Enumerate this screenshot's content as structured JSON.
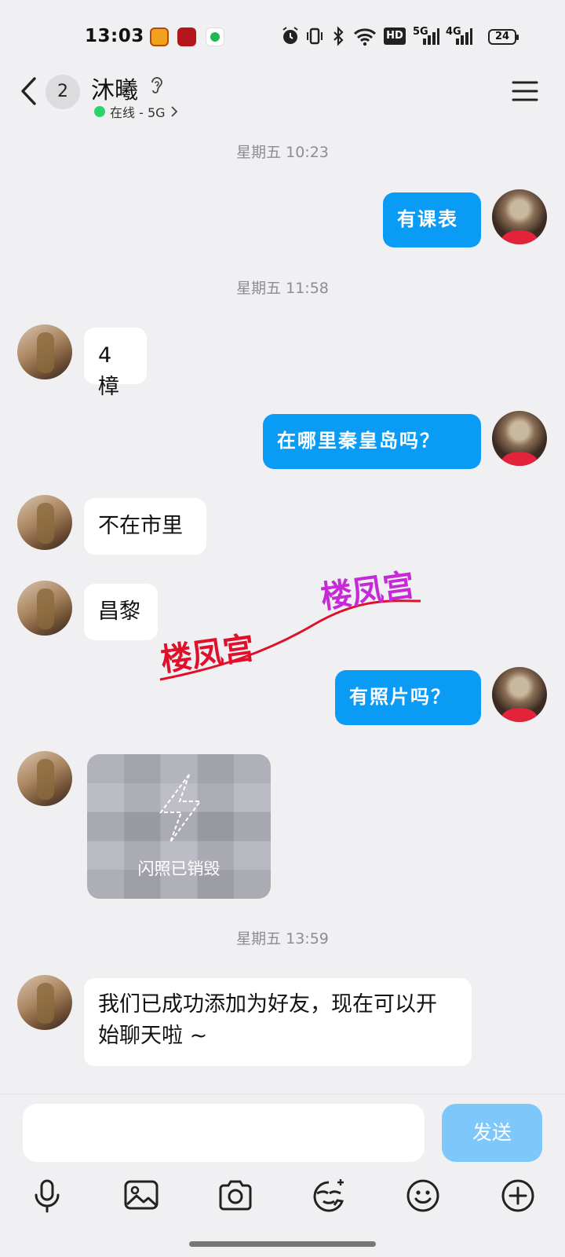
{
  "status_bar": {
    "time": "13:03",
    "network_badge": "HD",
    "signal_1": "5G",
    "signal_2": "4G",
    "battery": "24"
  },
  "header": {
    "unread_count": "2",
    "contact_name": "沐曦",
    "status": "在线 - 5G"
  },
  "chat": {
    "timestamps": [
      "星期五 10:23",
      "星期五 11:58",
      "星期五 13:59"
    ],
    "messages": [
      {
        "side": "me",
        "text": "有课表"
      },
      {
        "side": "her",
        "text": "4樟"
      },
      {
        "side": "me",
        "text": "在哪里秦皇岛吗？"
      },
      {
        "side": "her",
        "text": "不在市里"
      },
      {
        "side": "her",
        "text": "昌黎"
      },
      {
        "side": "me",
        "text": "有照片吗？"
      },
      {
        "side": "her",
        "text": "我们已成功添加为好友，现在可以开始聊天啦 ~"
      }
    ],
    "flash_photo_text": "闪照已销毁",
    "watermark": "楼凤宫"
  },
  "input": {
    "placeholder": "",
    "send_label": "发送"
  },
  "toolbar": {
    "icons": [
      "microphone-icon",
      "image-icon",
      "camera-icon",
      "sticker-icon",
      "emoji-icon",
      "plus-icon"
    ]
  },
  "colors": {
    "my_bubble": "#0a9bf5",
    "send_button": "#7ec7fa",
    "online": "#2ad36b",
    "background": "#f0f0f3"
  }
}
